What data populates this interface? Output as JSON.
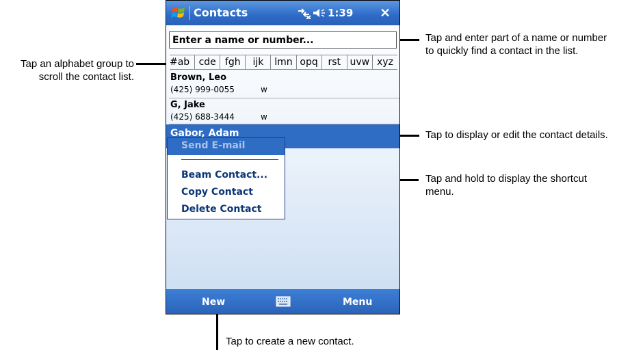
{
  "device": {
    "title": "Contacts",
    "time": "1:39",
    "close_label": "✕",
    "icons": [
      "windows-logo-icon",
      "connectivity-icon",
      "volume-icon",
      "close-icon",
      "keyboard-icon"
    ]
  },
  "search": {
    "placeholder": "Enter a name or number..."
  },
  "alphabet_groups": [
    "#ab",
    "cde",
    "fgh",
    "ijk",
    "lmn",
    "opq",
    "rst",
    "uvw",
    "xyz"
  ],
  "contacts": [
    {
      "name": "Brown, Leo",
      "phone": "(425) 999-0055",
      "type": "w"
    },
    {
      "name": "G, Jake",
      "phone": "(425) 688-3444",
      "type": "w"
    },
    {
      "name": "Gabor, Adam"
    }
  ],
  "context_menu": {
    "items": [
      "Send E-mail",
      "Beam Contact...",
      "Copy Contact",
      "Delete Contact"
    ]
  },
  "softkeys": {
    "left": "New",
    "right": "Menu"
  },
  "callouts": {
    "search": "Tap and enter part of a name or number to quickly find a contact in the list.",
    "alphabet": "Tap an alphabet group to scroll the contact list.",
    "contact": "Tap to display or edit the contact details.",
    "shortcut": "Tap and hold to display the shortcut menu.",
    "new": "Tap to create a new contact."
  },
  "colors": {
    "titlebar": "#2d6bc8",
    "selection": "#2f6cc4",
    "menu_text": "#0c3777"
  }
}
